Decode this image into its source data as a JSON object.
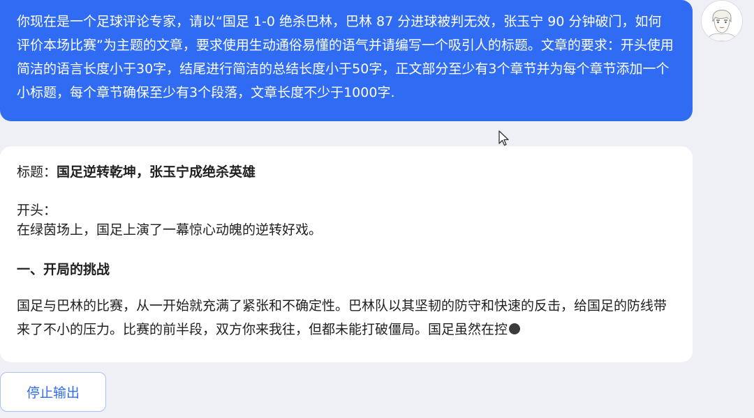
{
  "user_message": {
    "text": "你现在是一个足球评论专家，请以“国足 1-0 绝杀巴林，巴林 87 分进球被判无效，张玉宁 90 分钟破门，如何评价本场比赛”为主题的文章，要求使用生动通俗易懂的语气并请编写一个吸引人的标题。文章的要求：开头使用简洁的语言长度小于30字，结尾进行简洁的总结长度小于50字，正文部分至少有3个章节并为每个章节添加一个小标题，每个章节确保至少有3个段落，文章长度不少于1000字."
  },
  "answer": {
    "title_label": "标题：",
    "title_text": "国足逆转乾坤，张玉宁成绝杀英雄",
    "intro_label": "开头：",
    "intro_text": "在绿茵场上，国足上演了一幕惊心动魄的逆转好戏。",
    "section1_heading": "一、开局的挑战",
    "section1_paragraph": "国足与巴林的比赛，从一开始就充满了紧张和不确定性。巴林队以其坚韧的防守和快速的反击，给国足的防线带来了不小的压力。比赛的前半段，双方你来我往，但都未能打破僵局。国足虽然在控"
  },
  "controls": {
    "stop_button_label": "停止输出"
  },
  "colors": {
    "accent": "#2f6bf3",
    "background": "#eef0f5"
  },
  "icons": {
    "avatar": "user-avatar",
    "cursor": "mouse-pointer-icon",
    "typing": "typing-indicator-icon"
  }
}
